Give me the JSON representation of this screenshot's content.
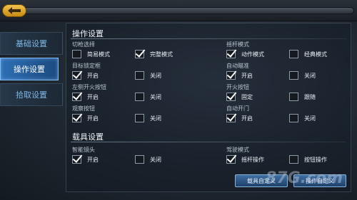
{
  "nav": {
    "back_icon": "back-arrow-icon"
  },
  "sidebar": {
    "items": [
      {
        "label": "基础设置",
        "active": false
      },
      {
        "label": "操作设置",
        "active": true
      },
      {
        "label": "拾取设置",
        "active": false
      }
    ]
  },
  "sections": {
    "operation": {
      "title": "操作设置",
      "groups": {
        "fire_mode": {
          "label": "切枪选择",
          "opt1": "简易模式",
          "opt2": "完整模式",
          "checked": 2
        },
        "joystick_mode": {
          "label": "摇杆模式",
          "opt1": "动作模式",
          "opt2": "经典模式",
          "checked": 1
        },
        "target_frame": {
          "label": "目标锁定框",
          "opt1": "开启",
          "opt2": "关闭",
          "checked": 1
        },
        "auto_aim": {
          "label": "自动瞄准",
          "opt1": "开启",
          "opt2": "关闭",
          "checked": 1
        },
        "left_fire": {
          "label": "左侧开火按钮",
          "opt1": "开启",
          "opt2": "关闭",
          "checked": 1
        },
        "fire_button": {
          "label": "开火按钮",
          "opt1": "固定",
          "opt2": "跟随",
          "checked": 1
        },
        "observe_button": {
          "label": "观察按钮",
          "opt1": "开启",
          "opt2": "关闭",
          "checked": 1
        },
        "auto_door": {
          "label": "自动开门",
          "opt1": "开启",
          "opt2": "关闭",
          "checked": 1
        }
      }
    },
    "vehicle": {
      "title": "载具设置",
      "groups": {
        "smart_camera": {
          "label": "智能镜头",
          "opt1": "开启",
          "opt2": "关闭",
          "checked": 1
        },
        "drive_mode": {
          "label": "驾驶模式",
          "opt1": "摇杆操作",
          "opt2": "按钮操作",
          "checked": 1
        }
      }
    }
  },
  "buttons": {
    "vehicle_custom": "载具自定义",
    "operation_custom": "操作自定义"
  },
  "watermark": "87G.com"
}
